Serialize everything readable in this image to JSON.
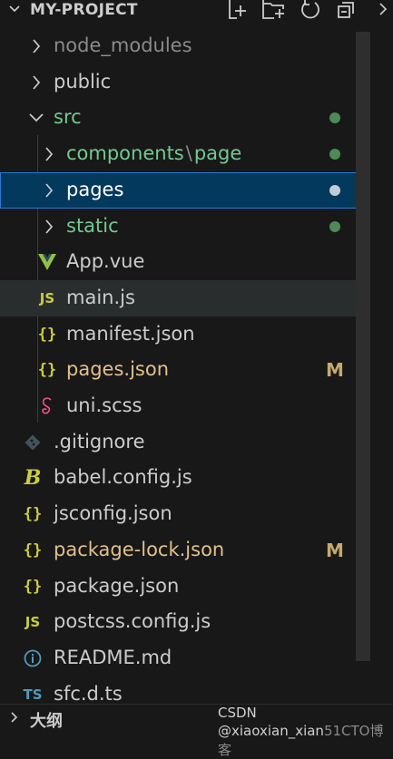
{
  "explorer": {
    "title": "MY-PROJECT",
    "actions": [
      "new-file",
      "new-folder",
      "refresh",
      "collapse-all"
    ]
  },
  "tree": [
    {
      "label": "node_modules",
      "type": "folder",
      "state": "collapsed",
      "depth": 1,
      "color": "#8b8b8b",
      "icon": "chevron-right-icon",
      "decoration": ""
    },
    {
      "label": "public",
      "type": "folder",
      "state": "collapsed",
      "depth": 1,
      "color": "#cccccc",
      "icon": "chevron-right-icon",
      "decoration": ""
    },
    {
      "label": "src",
      "type": "folder",
      "state": "expanded",
      "depth": 1,
      "color": "#73c991",
      "icon": "chevron-down-icon",
      "decoration": "dot"
    },
    {
      "label": "components",
      "sep": "\\",
      "label2": "page",
      "type": "folder",
      "state": "collapsed",
      "depth": 2,
      "color": "#73c991",
      "icon": "chevron-right-icon",
      "decoration": "dot"
    },
    {
      "label": "pages",
      "type": "folder",
      "state": "collapsed",
      "depth": 2,
      "color": "#ffffff",
      "icon": "chevron-right-icon",
      "decoration": "dot",
      "selected": true
    },
    {
      "label": "static",
      "type": "folder",
      "state": "collapsed",
      "depth": 2,
      "color": "#73c991",
      "icon": "chevron-right-icon",
      "decoration": "dot"
    },
    {
      "label": "App.vue",
      "type": "file",
      "depth": 2,
      "color": "#cccccc",
      "icon": "vue-icon",
      "decoration": ""
    },
    {
      "label": "main.js",
      "type": "file",
      "depth": 2,
      "color": "#cccccc",
      "icon": "js-icon",
      "decoration": "",
      "hover": true
    },
    {
      "label": "manifest.json",
      "type": "file",
      "depth": 2,
      "color": "#cccccc",
      "icon": "json-icon",
      "decoration": ""
    },
    {
      "label": "pages.json",
      "type": "file",
      "depth": 2,
      "color": "#e2c08d",
      "icon": "json-icon",
      "decoration": "M"
    },
    {
      "label": "uni.scss",
      "type": "file",
      "depth": 2,
      "color": "#cccccc",
      "icon": "sass-icon",
      "decoration": ""
    },
    {
      "label": ".gitignore",
      "type": "file",
      "depth": 1,
      "color": "#cccccc",
      "icon": "git-icon",
      "decoration": ""
    },
    {
      "label": "babel.config.js",
      "type": "file",
      "depth": 1,
      "color": "#cccccc",
      "icon": "babel-icon",
      "decoration": ""
    },
    {
      "label": "jsconfig.json",
      "type": "file",
      "depth": 1,
      "color": "#cccccc",
      "icon": "json-icon",
      "decoration": ""
    },
    {
      "label": "package-lock.json",
      "type": "file",
      "depth": 1,
      "color": "#e2c08d",
      "icon": "json-icon",
      "decoration": "M"
    },
    {
      "label": "package.json",
      "type": "file",
      "depth": 1,
      "color": "#cccccc",
      "icon": "json-icon",
      "decoration": ""
    },
    {
      "label": "postcss.config.js",
      "type": "file",
      "depth": 1,
      "color": "#cccccc",
      "icon": "js-icon",
      "decoration": ""
    },
    {
      "label": "README.md",
      "type": "file",
      "depth": 1,
      "color": "#cccccc",
      "icon": "info-icon",
      "decoration": ""
    },
    {
      "label": "sfc.d.ts",
      "type": "file",
      "depth": 1,
      "color": "#cccccc",
      "icon": "ts-icon",
      "decoration": ""
    }
  ],
  "outline": {
    "title": "大纲"
  },
  "watermark": {
    "text": "CSDN @xiaoxian_xian",
    "faint": "51CTO博客"
  }
}
